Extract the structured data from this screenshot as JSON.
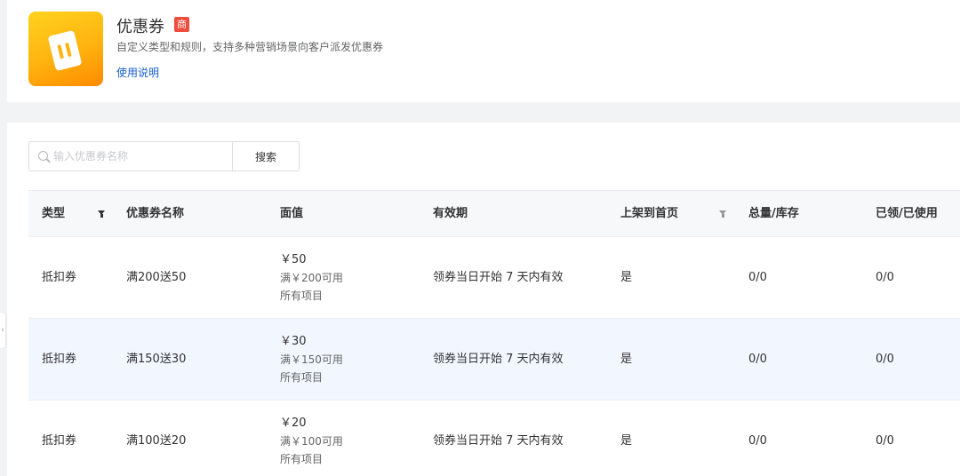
{
  "header": {
    "title": "优惠券",
    "badge": "商",
    "description": "自定义类型和规则，支持多种营销场景向客户派发优惠券",
    "help_link": "使用说明"
  },
  "search": {
    "placeholder": "输入优惠券名称",
    "value": "",
    "button_label": "搜索"
  },
  "table": {
    "columns": {
      "type": "类型",
      "name": "优惠券名称",
      "value": "面值",
      "validity": "有效期",
      "homepage": "上架到首页",
      "stock": "总量/库存",
      "used": "已领/已使用"
    },
    "rows": [
      {
        "type": "抵扣券",
        "name": "满200送50",
        "amount": "￥50",
        "condition": "满￥200可用",
        "scope": "所有项目",
        "validity": "领券当日开始 7 天内有效",
        "homepage": "是",
        "stock": "0/0",
        "used": "0/0"
      },
      {
        "type": "抵扣券",
        "name": "满150送30",
        "amount": "￥30",
        "condition": "满￥150可用",
        "scope": "所有项目",
        "validity": "领券当日开始 7 天内有效",
        "homepage": "是",
        "stock": "0/0",
        "used": "0/0"
      },
      {
        "type": "抵扣券",
        "name": "满100送20",
        "amount": "￥20",
        "condition": "满￥100可用",
        "scope": "所有项目",
        "validity": "领券当日开始 7 天内有效",
        "homepage": "是",
        "stock": "0/0",
        "used": "0/0"
      }
    ]
  },
  "colors": {
    "accent": "#155bd4",
    "badge": "#ee4d3d",
    "row_highlight": "#f2f7ff"
  },
  "icons": {
    "app": "coupon-ticket-icon",
    "search": "search-icon",
    "type_filter": "filter-icon",
    "homepage_filter": "filter-icon",
    "collapse": "chevron-left-icon"
  },
  "collapse_tab": "‹"
}
